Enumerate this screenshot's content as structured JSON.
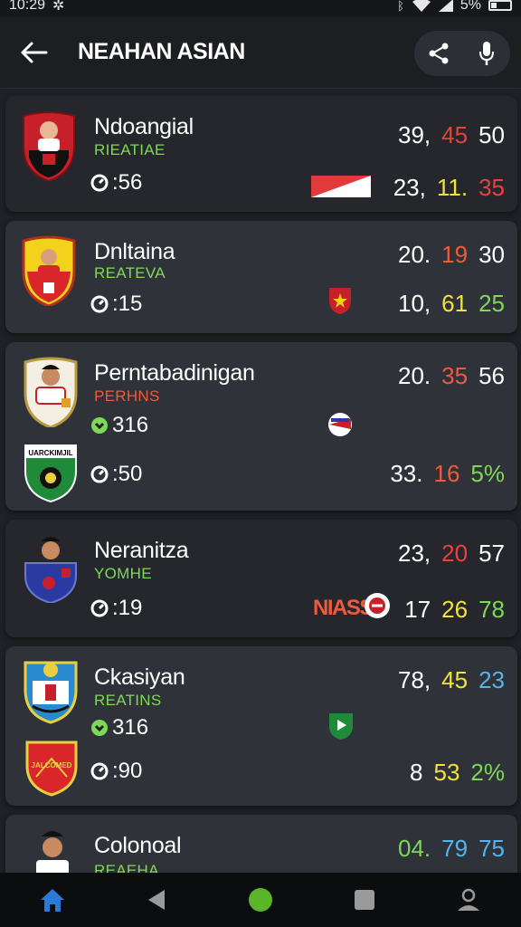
{
  "status": {
    "time": "10:29",
    "battery": "5%"
  },
  "header": {
    "title": "NEAHAN ASIAN"
  },
  "colors": {
    "white": "#ffffff",
    "red": "#e8423a",
    "yellow": "#f2e23a",
    "green": "#7ed957",
    "blue": "#4fb6ee",
    "orange_red": "#f05a3a"
  },
  "matches": [
    {
      "team": "Ndoangial",
      "league": "RIEATIAE",
      "time": ":56",
      "score_top": [
        "39,",
        "45",
        "50"
      ],
      "score_bottom": [
        "23,",
        "11.",
        "35"
      ]
    },
    {
      "team": "Dnltaina",
      "league": "REATEVA",
      "time": ":15",
      "score_top": [
        "20.",
        "19",
        "30"
      ],
      "score_bottom": [
        "10,",
        "61",
        "25"
      ]
    },
    {
      "team": "Perntabadinigan",
      "league": "PERHNS",
      "time": "316",
      "time2": ":50",
      "score_top": [
        "20.",
        "35",
        "56"
      ],
      "score_bottom": [
        "33.",
        "16",
        "5%"
      ],
      "crest2_text": "UARCKIMJIL"
    },
    {
      "team": "Neranitza",
      "league": "YOMHE",
      "time": ":19",
      "mid_label": "NIASS",
      "score_top": [
        "23,",
        "20",
        "57"
      ],
      "score_bottom": [
        "17",
        "26",
        "78"
      ]
    },
    {
      "team": "Ckasiyan",
      "league": "REATINS",
      "time": "316",
      "time2": ":90",
      "crest2_text": "JALCOMED",
      "score_top": [
        "78,",
        "45",
        "23"
      ],
      "score_bottom": [
        "8",
        "53",
        "2%"
      ]
    },
    {
      "team": "Colonoal",
      "league": "REAEHA",
      "score_top": [
        "04.",
        "79",
        "75"
      ]
    }
  ]
}
